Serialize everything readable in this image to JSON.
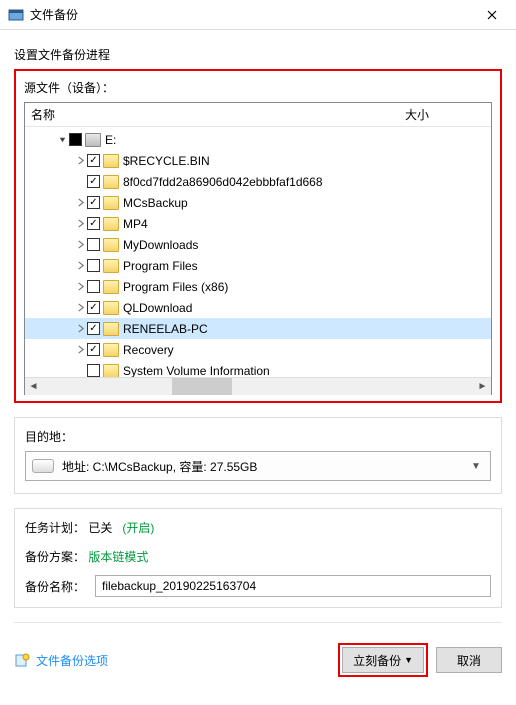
{
  "window": {
    "title": "文件备份"
  },
  "section_title": "设置文件备份进程",
  "source": {
    "label": "源文件（设备）：",
    "columns": {
      "name": "名称",
      "size": "大小"
    },
    "root_label": "E:",
    "items": [
      {
        "label": "$RECYCLE.BIN",
        "checked": true,
        "chevron": true
      },
      {
        "label": "8f0cd7fdd2a86906d042ebbbfaf1d668",
        "checked": true,
        "chevron": false
      },
      {
        "label": "MCsBackup",
        "checked": true,
        "chevron": true
      },
      {
        "label": "MP4",
        "checked": true,
        "chevron": true
      },
      {
        "label": "MyDownloads",
        "checked": false,
        "chevron": true
      },
      {
        "label": "Program Files",
        "checked": false,
        "chevron": true
      },
      {
        "label": "Program Files (x86)",
        "checked": false,
        "chevron": true
      },
      {
        "label": "QLDownload",
        "checked": true,
        "chevron": true
      },
      {
        "label": "RENEELAB-PC",
        "checked": true,
        "chevron": true,
        "selected": true
      },
      {
        "label": "Recovery",
        "checked": true,
        "chevron": true
      },
      {
        "label": "System Volume Information",
        "checked": false,
        "chevron": false
      }
    ]
  },
  "dest": {
    "label": "目的地：",
    "text": "地址: C:\\MCsBackup, 容量: 27.55GB"
  },
  "schedule": {
    "label": "任务计划：",
    "status": "已关",
    "toggle": "(开启)"
  },
  "scheme": {
    "label": "备份方案：",
    "value": "版本链模式"
  },
  "name": {
    "label": "备份名称：",
    "value": "filebackup_20190225163704"
  },
  "footer": {
    "options_link": "文件备份选项",
    "backup": "立刻备份",
    "cancel": "取消"
  }
}
